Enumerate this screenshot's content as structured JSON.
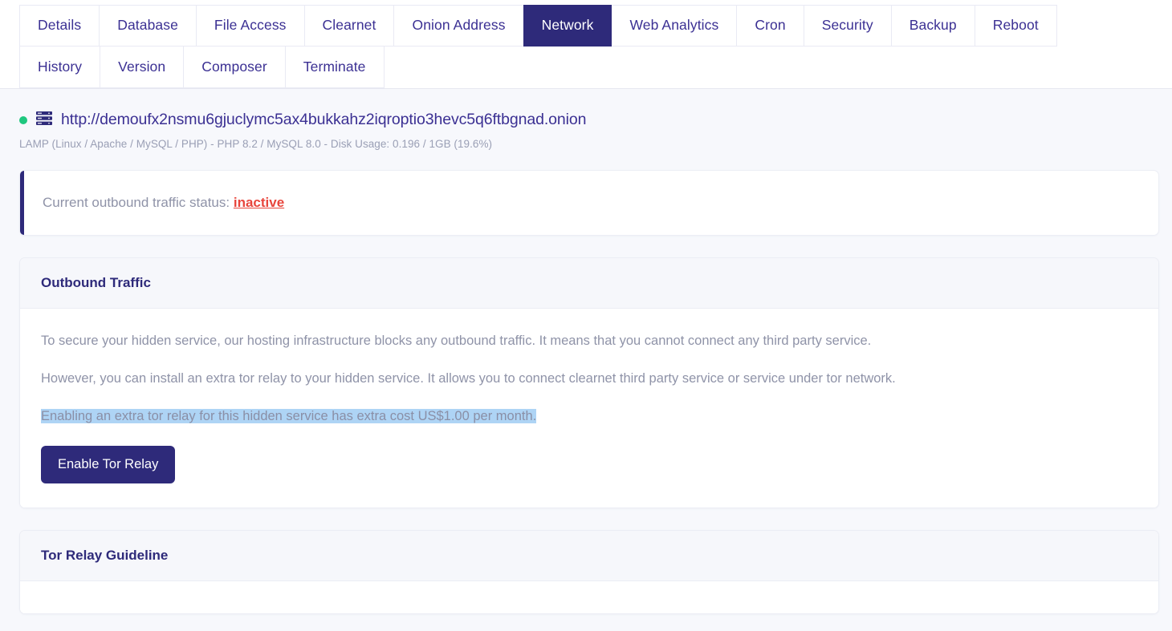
{
  "tabs": {
    "row1": [
      {
        "label": "Details",
        "active": false
      },
      {
        "label": "Database",
        "active": false
      },
      {
        "label": "File Access",
        "active": false
      },
      {
        "label": "Clearnet",
        "active": false
      },
      {
        "label": "Onion Address",
        "active": false
      },
      {
        "label": "Network",
        "active": true
      },
      {
        "label": "Web Analytics",
        "active": false
      },
      {
        "label": "Cron",
        "active": false
      },
      {
        "label": "Security",
        "active": false
      },
      {
        "label": "Backup",
        "active": false
      },
      {
        "label": "Reboot",
        "active": false
      }
    ],
    "row2": [
      {
        "label": "History",
        "active": false
      },
      {
        "label": "Version",
        "active": false
      },
      {
        "label": "Composer",
        "active": false
      },
      {
        "label": "Terminate",
        "active": false
      }
    ]
  },
  "service": {
    "status_dot_color": "#1fc77f",
    "url": "http://demoufx2nsmu6gjuclymc5ax4bukkahz2iqroptio3hevc5q6ftbgnad.onion",
    "stack_info": "LAMP (Linux / Apache / MySQL / PHP) - PHP 8.2 / MySQL 8.0 - Disk Usage: 0.196 / 1GB (19.6%)"
  },
  "alert": {
    "prefix": "Current outbound traffic status:",
    "status": "inactive",
    "status_color": "#e8453c",
    "accent_color": "#2e2a7a"
  },
  "outbound_card": {
    "title": "Outbound Traffic",
    "paragraph1": "To secure your hidden service, our hosting infrastructure blocks any outbound traffic. It means that you cannot connect any third party service.",
    "paragraph2": "However, you can install an extra tor relay to your hidden service. It allows you to connect clearnet third party service or service under tor network.",
    "paragraph3_selected": "Enabling an extra tor relay for this hidden service has extra cost US$1.00 per month.",
    "selection_highlight_color": "#aed4f5",
    "button_label": "Enable Tor Relay"
  },
  "guideline_card": {
    "title": "Tor Relay Guideline"
  },
  "theme": {
    "brand": "#2e2a7a",
    "tab_text": "#3b3093",
    "page_bg": "#f7f8fc",
    "muted_text": "#8f93a8"
  }
}
